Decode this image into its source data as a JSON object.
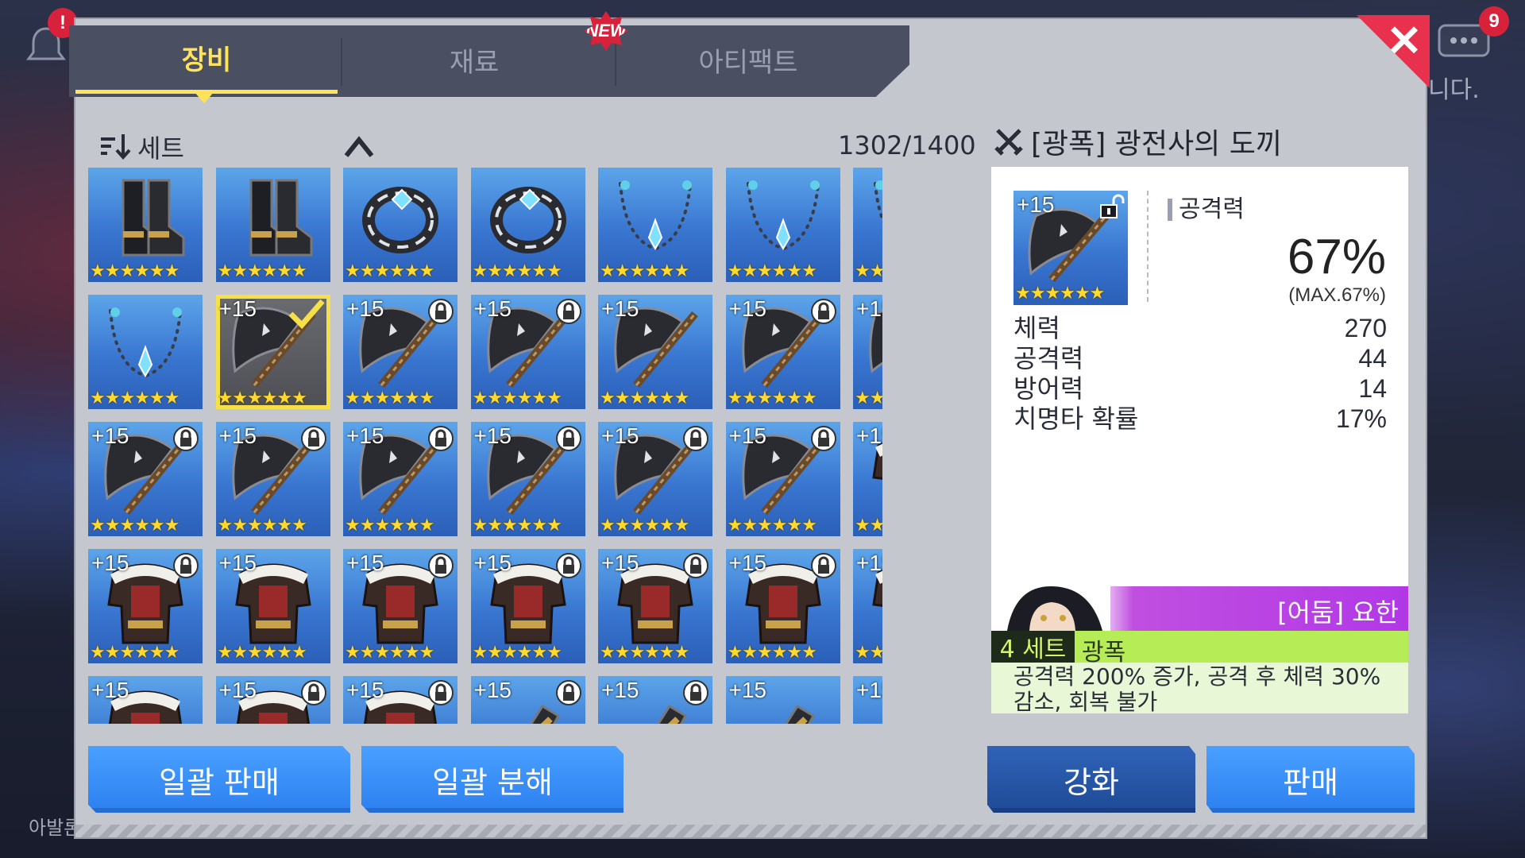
{
  "background": {
    "right_text": "니다.",
    "left_text": "아발론",
    "badge_left": "!",
    "badge_right": "9"
  },
  "tabs": [
    {
      "label": "장비",
      "active": true
    },
    {
      "label": "재료",
      "active": false
    },
    {
      "label": "아티팩트",
      "active": false
    }
  ],
  "new_badge": "NEW",
  "list": {
    "sort_label": "세트",
    "count": "1302/1400"
  },
  "items": [
    {
      "type": "boots",
      "level": "",
      "stars": 6,
      "locked": false
    },
    {
      "type": "boots",
      "level": "",
      "stars": 6,
      "locked": false
    },
    {
      "type": "ring",
      "level": "",
      "stars": 6,
      "locked": false
    },
    {
      "type": "ring",
      "level": "",
      "stars": 6,
      "locked": false
    },
    {
      "type": "necklace",
      "level": "",
      "stars": 6,
      "locked": false
    },
    {
      "type": "necklace",
      "level": "",
      "stars": 6,
      "locked": false
    },
    {
      "type": "necklace",
      "level": "",
      "stars": 6,
      "locked": false
    },
    {
      "type": "necklace",
      "level": "",
      "stars": 6,
      "locked": false
    },
    {
      "type": "axe",
      "level": "+15",
      "stars": 6,
      "locked": false,
      "selected": true
    },
    {
      "type": "axe",
      "level": "+15",
      "stars": 6,
      "locked": true
    },
    {
      "type": "axe",
      "level": "+15",
      "stars": 6,
      "locked": true
    },
    {
      "type": "axe",
      "level": "+15",
      "stars": 6,
      "locked": false
    },
    {
      "type": "axe",
      "level": "+15",
      "stars": 6,
      "locked": true
    },
    {
      "type": "axe",
      "level": "+15",
      "stars": 6,
      "locked": true
    },
    {
      "type": "axe",
      "level": "+15",
      "stars": 6,
      "locked": true
    },
    {
      "type": "axe",
      "level": "+15",
      "stars": 6,
      "locked": true
    },
    {
      "type": "axe",
      "level": "+15",
      "stars": 6,
      "locked": true
    },
    {
      "type": "axe",
      "level": "+15",
      "stars": 6,
      "locked": true
    },
    {
      "type": "axe",
      "level": "+15",
      "stars": 6,
      "locked": true
    },
    {
      "type": "axe",
      "level": "+15",
      "stars": 6,
      "locked": true
    },
    {
      "type": "armor",
      "level": "+15",
      "stars": 6,
      "locked": false
    },
    {
      "type": "armor",
      "level": "+15",
      "stars": 6,
      "locked": true
    },
    {
      "type": "armor",
      "level": "+15",
      "stars": 6,
      "locked": false
    },
    {
      "type": "armor",
      "level": "+15",
      "stars": 6,
      "locked": true
    },
    {
      "type": "armor",
      "level": "+15",
      "stars": 6,
      "locked": true
    },
    {
      "type": "armor",
      "level": "+15",
      "stars": 6,
      "locked": true
    },
    {
      "type": "armor",
      "level": "+15",
      "stars": 6,
      "locked": true
    },
    {
      "type": "armor",
      "level": "+15",
      "stars": 6,
      "locked": true
    },
    {
      "type": "armor",
      "level": "+15",
      "stars": 6,
      "locked": false
    },
    {
      "type": "armor",
      "level": "+15",
      "stars": 6,
      "locked": true
    },
    {
      "type": "armor",
      "level": "+15",
      "stars": 6,
      "locked": true
    },
    {
      "type": "gloves",
      "level": "+15",
      "stars": 6,
      "locked": true
    },
    {
      "type": "gloves",
      "level": "+15",
      "stars": 6,
      "locked": true
    },
    {
      "type": "gloves",
      "level": "+15",
      "stars": 6,
      "locked": false
    },
    {
      "type": "gloves",
      "level": "+15",
      "stars": 6,
      "locked": true
    }
  ],
  "detail": {
    "title": "[광폭] 광전사의 도끼",
    "level": "+15",
    "main_stat_label": "공격력",
    "main_stat_value": "67%",
    "main_stat_max": "(MAX.67%)",
    "sub_stats": [
      {
        "name": "체력",
        "value": "270"
      },
      {
        "name": "공격력",
        "value": "44"
      },
      {
        "name": "방어력",
        "value": "14"
      },
      {
        "name": "치명타 확률",
        "value": "17%"
      }
    ],
    "owner": "[어둠] 요한",
    "set_count": "4 세트",
    "set_name": "광폭",
    "set_desc_1": "공격력 200% 증가, 공격 후 체력 30%",
    "set_desc_2": "감소, 회복 불가"
  },
  "buttons": {
    "bulk_sell": "일괄 판매",
    "bulk_dismantle": "일괄 분해",
    "enhance": "강화",
    "sell": "판매"
  },
  "colors": {
    "accent_yellow": "#ffe45a",
    "button_blue": "#2c80f0",
    "owner_purple": "#b238e6",
    "set_green": "#b6ec55",
    "close_red": "#e8324d"
  }
}
